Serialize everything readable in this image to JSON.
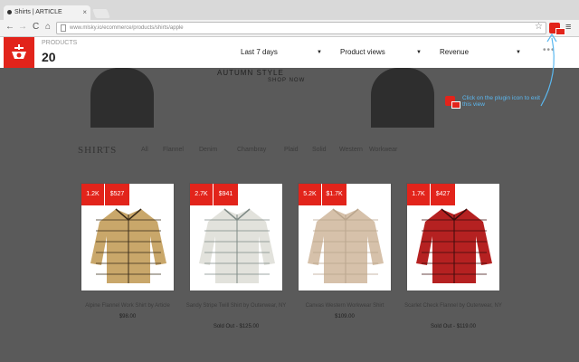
{
  "browser": {
    "tab_title": "Shirts | ARTICLE",
    "tab_close": "×",
    "url": "www.mlsky.io/ecommerce/products/shirts/apple",
    "nav_back": "←",
    "nav_forward": "→",
    "nav_reload": "C",
    "nav_home": "⌂",
    "bookmark_star": "☆",
    "menu": "≡"
  },
  "overlay": {
    "products_label": "PRODUCTS",
    "products_count": "20",
    "dropdowns": [
      {
        "value": "Last 7 days",
        "caret": "▼"
      },
      {
        "value": "Product views",
        "caret": "▼"
      },
      {
        "value": "Revenue",
        "caret": "▼"
      }
    ],
    "more": "•••",
    "accent_color": "#e2241b"
  },
  "page": {
    "hero_text": "AUTUMN STYLE",
    "shop_now": "SHOP NOW",
    "hint": "Click on the plugin icon to exit this view",
    "section_title": "SHIRTS",
    "filters": [
      "All",
      "Flannel",
      "Denim",
      "Chambray",
      "Plaid",
      "Solid",
      "Western",
      "Workwear"
    ]
  },
  "products": [
    {
      "views": "1.2K",
      "revenue": "$527",
      "name": "Alpine Flannel Work Shirt by Article",
      "price": "$98.00",
      "sale": "",
      "colors": {
        "base": "#c9a76a",
        "line": "#3a2c1a"
      }
    },
    {
      "views": "2.7K",
      "revenue": "$941",
      "name": "Sandy Stripe Twill Shirt by Outerwear, NY",
      "price": "",
      "sale": "Sold Out - $125.00",
      "colors": {
        "base": "#e2e2dc",
        "line": "#7f8a86"
      }
    },
    {
      "views": "5.2K",
      "revenue": "$1.7K",
      "name": "Canvas Western Workwear Shirt",
      "price": "$109.00",
      "sale": "",
      "colors": {
        "base": "#d6c1aa",
        "line": "#b9a58d"
      }
    },
    {
      "views": "1.7K",
      "revenue": "$427",
      "name": "Scarlet Check Flannel by Outerwear, NY",
      "price": "",
      "sale": "Sold Out - $119.00",
      "colors": {
        "base": "#b52121",
        "line": "#3b0c0c"
      }
    }
  ]
}
